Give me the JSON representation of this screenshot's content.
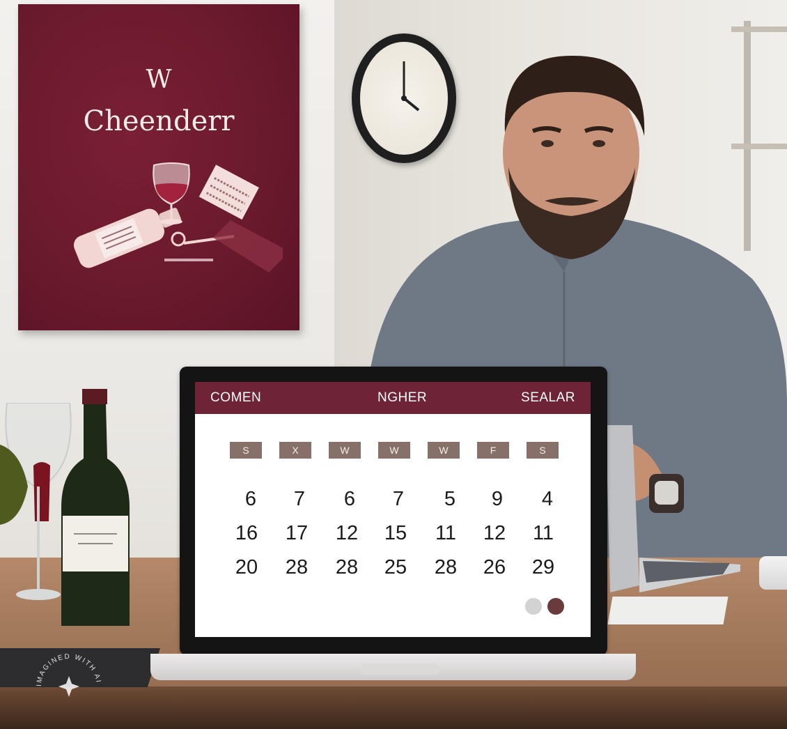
{
  "poster": {
    "line1": "W",
    "line2": "Cheenderr"
  },
  "calendar": {
    "header": {
      "left": "COMEN",
      "center": "NGHER",
      "right": "SEALAR"
    },
    "weekdays": [
      "S",
      "X",
      "W",
      "W",
      "W",
      "F",
      "S"
    ],
    "weeks": [
      [
        "6",
        "7",
        "6",
        "7",
        "5",
        "9",
        "4"
      ],
      [
        "16",
        "17",
        "12",
        "15",
        "11",
        "12",
        "11"
      ],
      [
        "20",
        "28",
        "28",
        "25",
        "28",
        "26",
        "29"
      ]
    ]
  },
  "watermark": {
    "text": "IMAGINED WITH AI"
  },
  "colors": {
    "header_bg": "#6e2336",
    "weekday_chip": "#87706a",
    "poster_bg": "#6b1a2d",
    "dot_light": "#d4d2d2",
    "dot_dark": "#6a3b3c"
  }
}
